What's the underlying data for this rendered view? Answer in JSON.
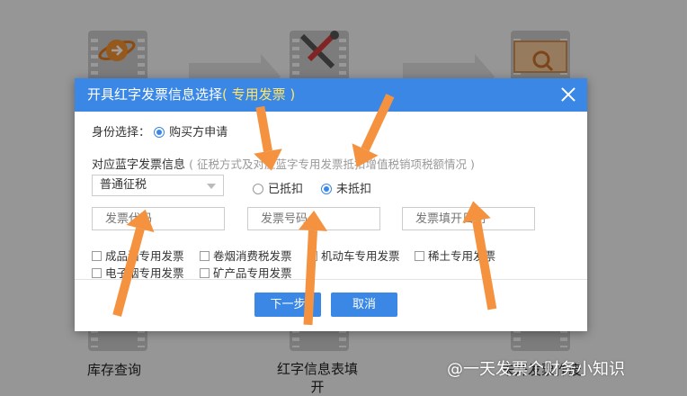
{
  "background": {
    "tiles": [
      {
        "label": "库存查询"
      },
      {
        "label": "红字信息表填\n开"
      },
      {
        "label": "未开发票作废"
      }
    ]
  },
  "dialog": {
    "title": "开具红字发票信息选择",
    "title_sub": "( 专用发票 )",
    "identity_label": "身份选择：",
    "identity_option": "购买方申请",
    "blue_info_label": "对应蓝字发票信息",
    "blue_info_hint": "( 征税方式及对应蓝字专用发票抵扣增值税销项税额情况 )",
    "tax_mode": "普通征税",
    "deducted_label": "已抵扣",
    "not_deducted_label": "未抵扣",
    "selected_deduction": "未抵扣",
    "invoice_code_placeholder": "发票代码",
    "invoice_number_placeholder": "发票号码",
    "invoice_date_placeholder": "发票填开日期",
    "checkboxes": [
      "成品油专用发票",
      "卷烟消费税发票",
      "机动车专用发票",
      "稀土专用发票",
      "电子烟专用发票",
      "矿产品专用发票"
    ],
    "next_button": "下一步",
    "cancel_button": "取消"
  },
  "watermark": "@一天发票个财务小知识",
  "colors": {
    "title_bar": "#3a87e6",
    "title_sub": "#ffe56a",
    "arrow": "#f4923f",
    "button": "#3a87e6"
  }
}
